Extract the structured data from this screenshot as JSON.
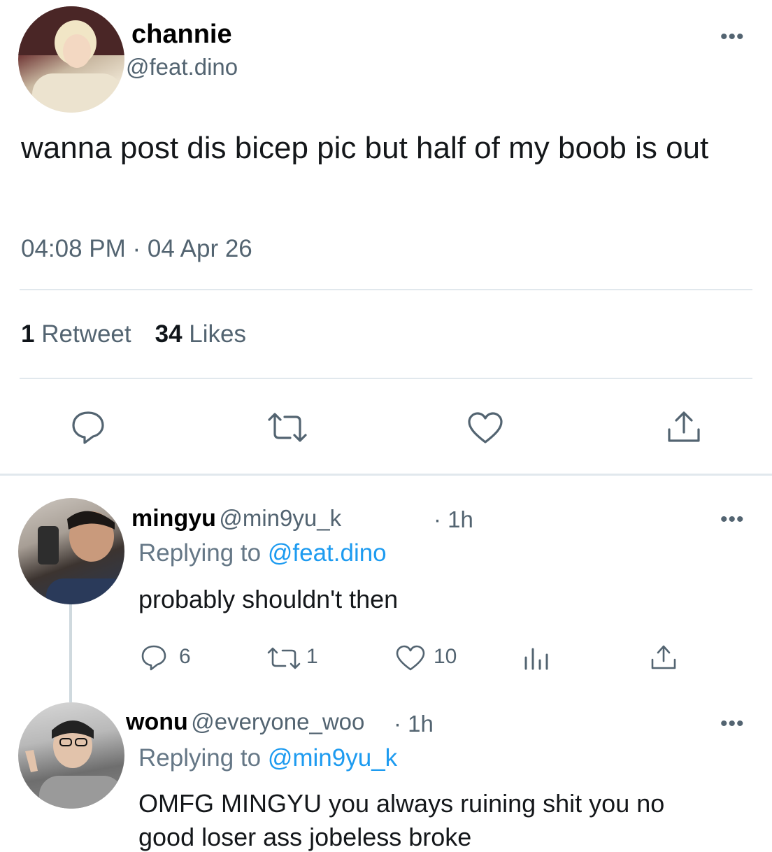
{
  "tweet": {
    "author": {
      "display_name": "channie",
      "handle": "@feat.dino",
      "avatar_icon": "avatar-photo"
    },
    "text": "wanna post dis bicep pic but half of my boob is out",
    "timestamp": "04:08 PM · 04 Apr 26",
    "stats": {
      "retweets_count": "1",
      "retweets_label": "Retweet",
      "likes_count": "34",
      "likes_label": "Likes"
    },
    "actions": [
      "reply-icon",
      "retweet-icon",
      "like-icon",
      "share-icon"
    ],
    "more_label": "•••"
  },
  "replies": [
    {
      "display_name": "mingyu",
      "handle": "@min9yu_k",
      "time": "· 1h",
      "replying_prefix": "Replying to",
      "replying_to": "@feat.dino",
      "text": "probably shouldn't then",
      "counts": {
        "replies": "6",
        "retweets": "1",
        "likes": "10"
      },
      "more_label": "•••"
    },
    {
      "display_name": "wonu",
      "handle": "@everyone_woo",
      "time": "· 1h",
      "replying_prefix": "Replying to",
      "replying_to": "@min9yu_k",
      "text": "OMFG MINGYU you always ruining shit you no",
      "text_line2": "good loser ass jobeless broke",
      "more_label": "•••"
    }
  ],
  "colors": {
    "accent": "#1d9bf0",
    "secondary_text": "#536471",
    "divider": "#e1e8ed"
  }
}
